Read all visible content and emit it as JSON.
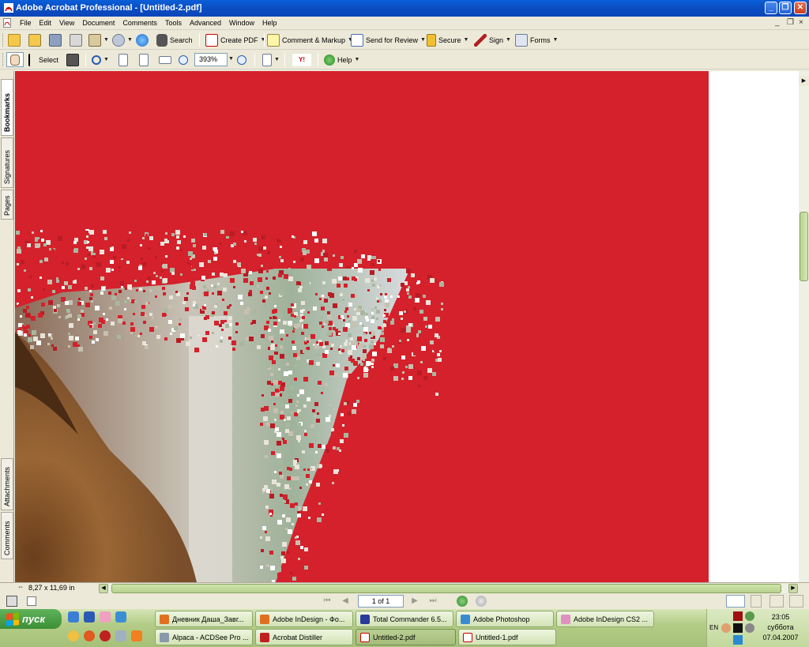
{
  "window": {
    "title": "Adobe Acrobat Professional - [Untitled-2.pdf]",
    "buttons": [
      "_",
      "❐",
      "✕"
    ],
    "doc_buttons": [
      "_",
      "❐",
      "×"
    ]
  },
  "menu": [
    "File",
    "Edit",
    "View",
    "Document",
    "Comments",
    "Tools",
    "Advanced",
    "Window",
    "Help"
  ],
  "toolbar1": {
    "search": "Search",
    "create_pdf": "Create PDF",
    "comment_markup": "Comment & Markup",
    "send_review": "Send for Review",
    "secure": "Secure",
    "sign": "Sign",
    "forms": "Forms"
  },
  "toolbar2": {
    "select": "Select",
    "zoom": "393%",
    "help": "Help"
  },
  "leftnav": {
    "tabs": [
      "Bookmarks",
      "Signatures",
      "Pages"
    ],
    "bottom_tabs": [
      "Attachments",
      "Comments"
    ]
  },
  "status": {
    "page_size": "8,27 x 11,69 in",
    "page_field": "1 of 1"
  },
  "taskbar": {
    "start": "пуск",
    "tasks_row1": [
      "Дневник Даша_Завг...",
      "Adobe InDesign - Фо...",
      "Total Commander 6.5...",
      "Adobe Photoshop",
      "Adobe InDesign CS2 ..."
    ],
    "tasks_row2": [
      "Alpaca - ACDSee Pro ...",
      "Acrobat Distiller",
      "Untitled-2.pdf",
      "Untitled-1.pdf"
    ],
    "lang": "EN",
    "time": "23:05",
    "day": "суббота",
    "date": "07.04.2007"
  },
  "colors": {
    "page_red": "#d4212b",
    "titlebar": "#0b4ec4",
    "taskbar": "#b3cc87"
  }
}
